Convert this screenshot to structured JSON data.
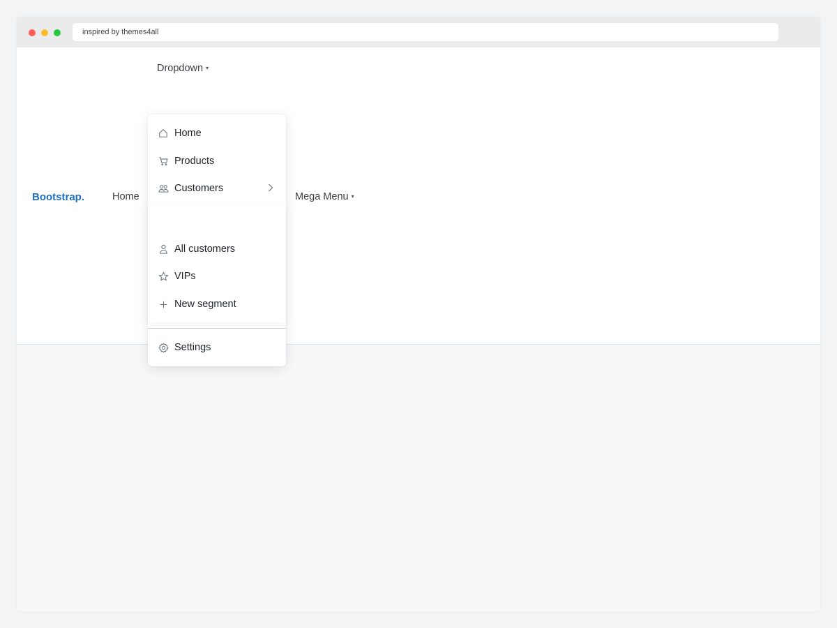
{
  "browser": {
    "address": "inspired by themes4all"
  },
  "nav": {
    "brand": "Bootstrap.",
    "home": "Home",
    "mega_menu": "Mega Menu",
    "top_dropdown": "Dropdown",
    "caret": "▾"
  },
  "dropdown": {
    "items": [
      {
        "label": "Home",
        "icon": "home-icon"
      },
      {
        "label": "Products",
        "icon": "cart-icon"
      },
      {
        "label": "Customers",
        "icon": "users-icon"
      }
    ],
    "submenu": [
      {
        "label": "All customers",
        "icon": "user-icon"
      },
      {
        "label": "VIPs",
        "icon": "star-icon"
      },
      {
        "label": "New segment",
        "icon": "plus-icon"
      }
    ],
    "settings": {
      "label": "Settings",
      "icon": "gear-icon"
    }
  },
  "colors": {
    "brand": "#1b6ec2",
    "background": "#f3f4f6"
  }
}
